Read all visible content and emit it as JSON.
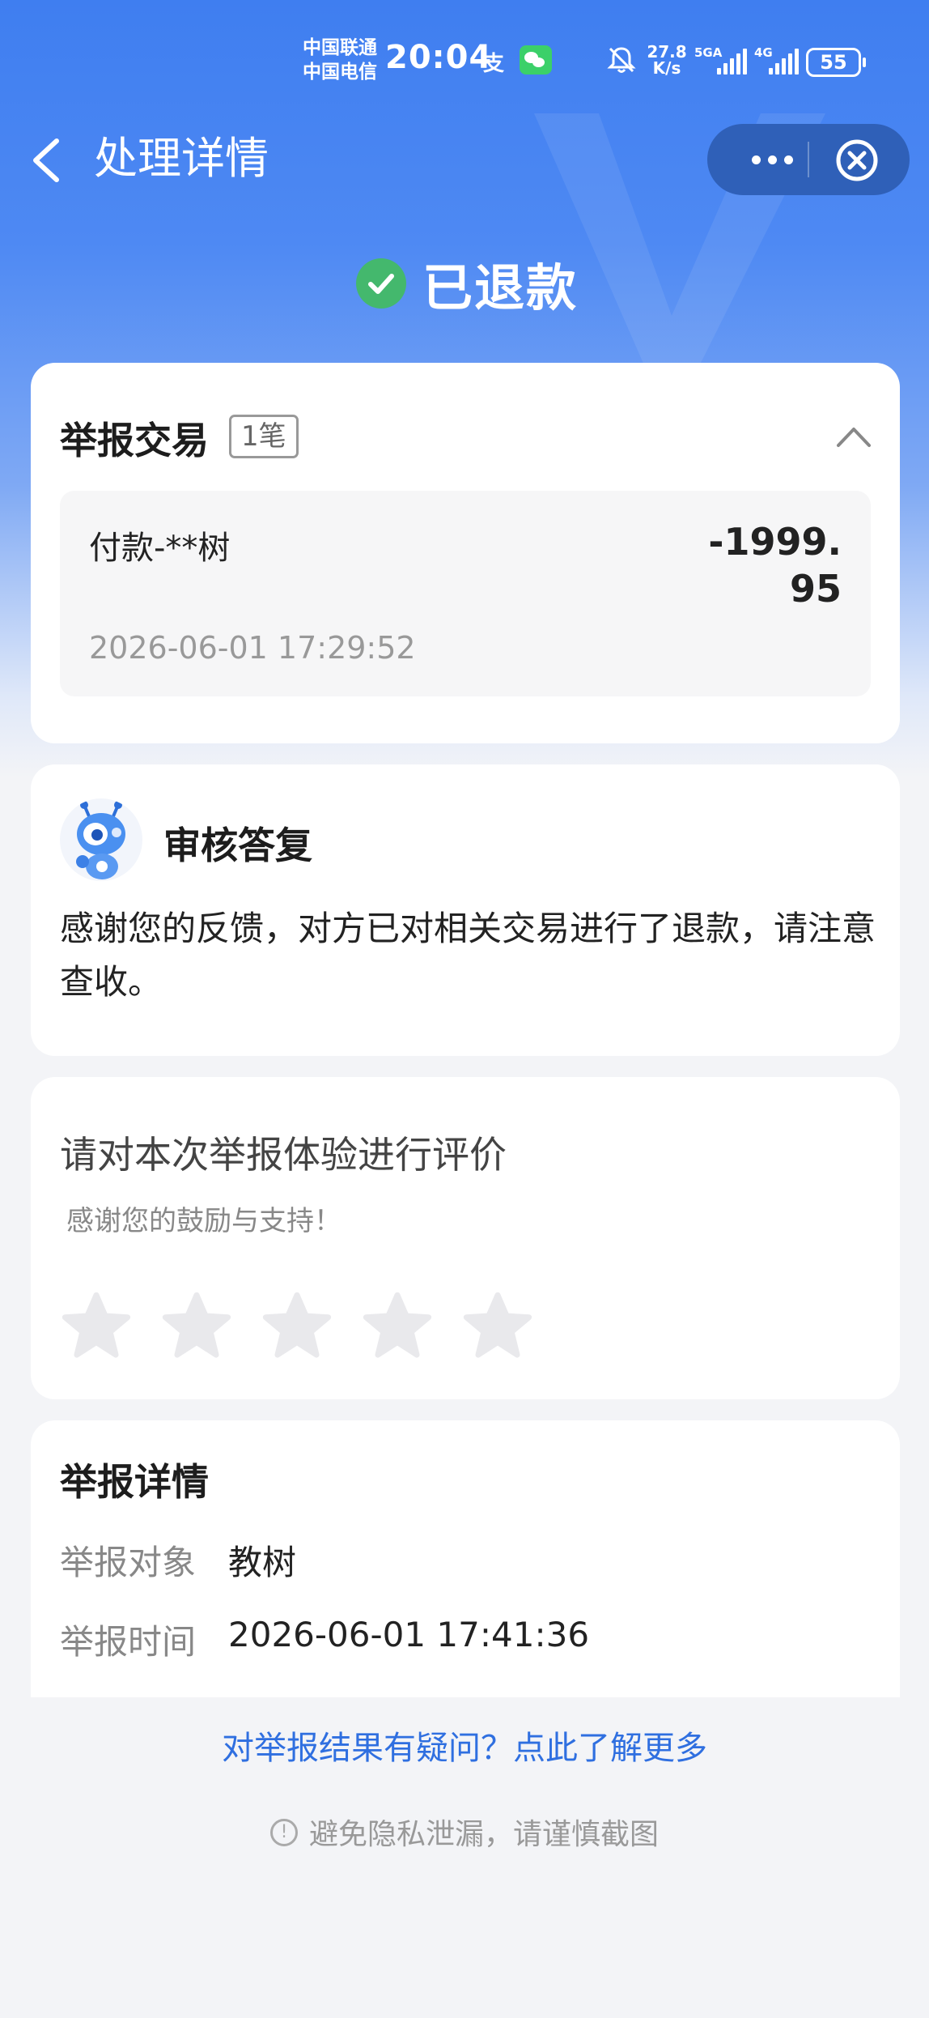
{
  "status_bar": {
    "carrier_1": "中国联通",
    "carrier_2": "中国电信",
    "time": "20:04",
    "alipay_glyph": "支",
    "net_speed_value": "27.8",
    "net_speed_unit": "K/s",
    "signal_1_label": "5GA",
    "signal_2_label": "4G",
    "battery": "55",
    "icons": [
      "alipay-icon",
      "wechat-icon",
      "mute-bell-icon",
      "signal-icon",
      "battery-icon"
    ]
  },
  "nav": {
    "title": "处理详情",
    "back_icon": "chevron-left-icon",
    "more_icon": "more-dots-icon",
    "close_icon": "close-circle-icon"
  },
  "status": {
    "text": "已退款",
    "icon": "check-circle-icon",
    "icon_color": "#44b86d"
  },
  "transaction_card": {
    "title": "举报交易",
    "count_badge": "1笔",
    "transaction": {
      "name": "付款-**树",
      "amount": "-1999.95",
      "time": "2026-06-01 17:29:52"
    }
  },
  "review_card": {
    "title": "审核答复",
    "message": "感谢您的反馈，对方已对相关交易进行了退款，请注意查收。"
  },
  "rating_card": {
    "title": "请对本次举报体验进行评价",
    "subtitle": "感谢您的鼓励与支持！",
    "star_count": 5,
    "rating": 0
  },
  "details_card": {
    "title": "举报详情",
    "rows": [
      {
        "label": "举报对象",
        "value": "教树"
      },
      {
        "label": "举报时间",
        "value": "2026-06-01 17:41:36"
      }
    ]
  },
  "footer": {
    "faq_link": "对举报结果有疑问？点此了解更多",
    "privacy_note": "避免隐私泄漏，请谨慎截图"
  },
  "colors": {
    "header_blue": "#3f7ef0",
    "link_blue": "#2f6fe0",
    "capsule": "#2f60b8",
    "success_green": "#44b86d",
    "background": "#f3f4f7"
  }
}
